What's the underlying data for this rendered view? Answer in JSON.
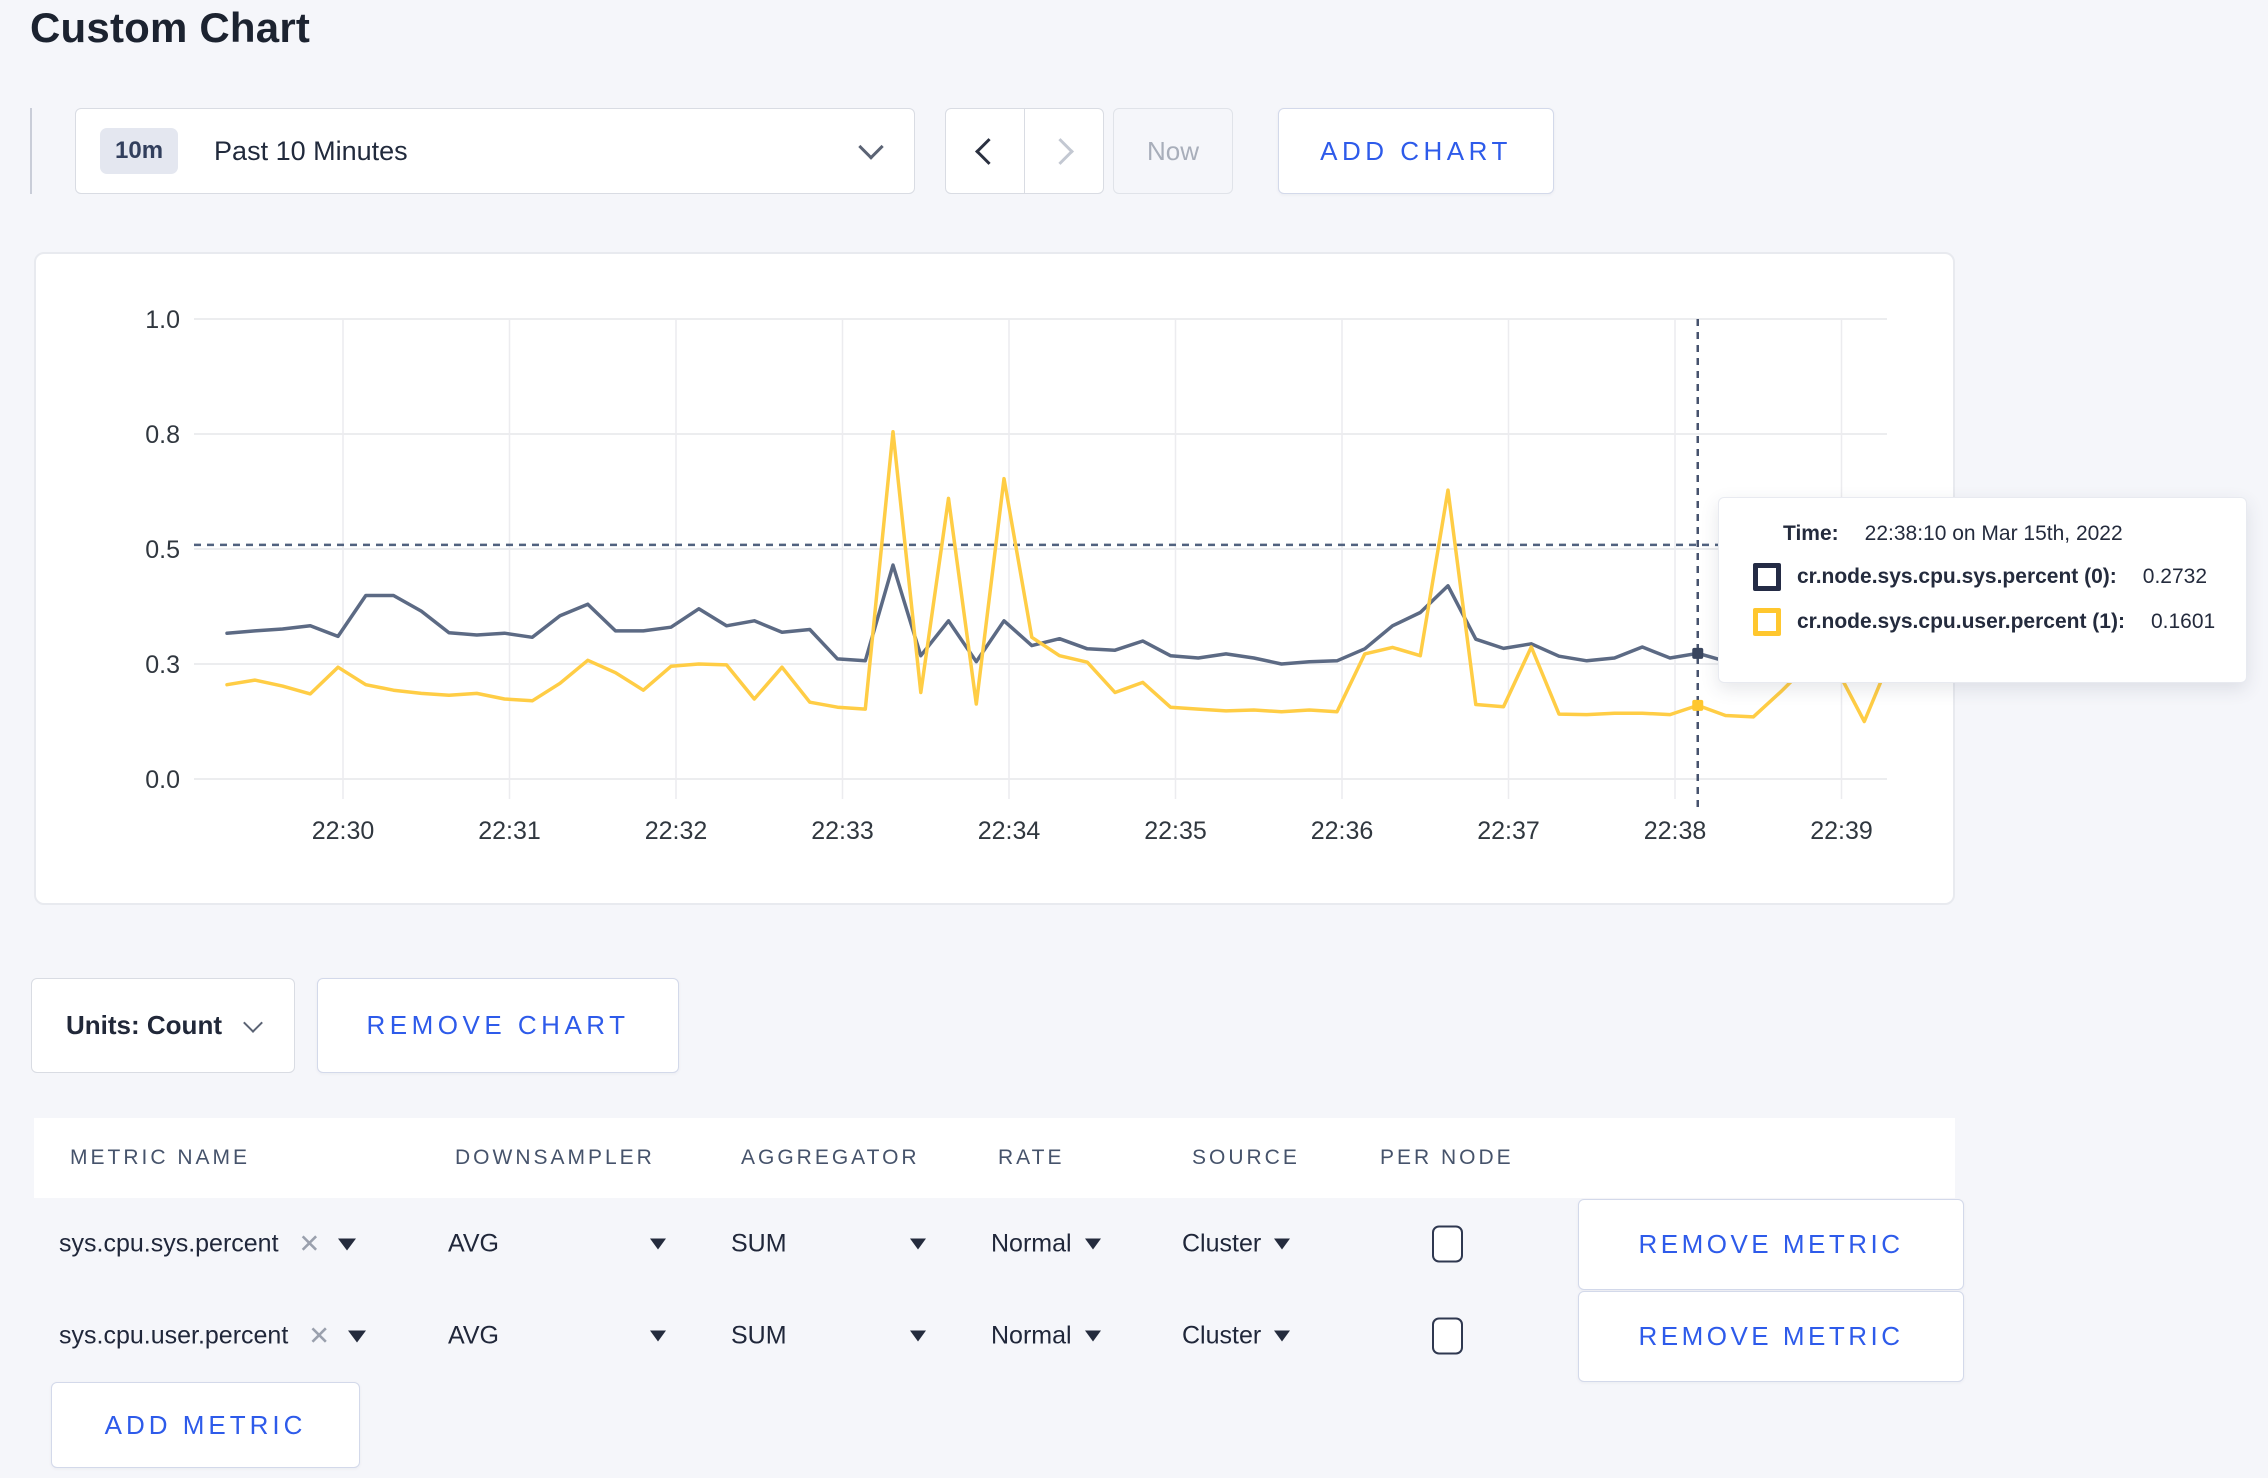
{
  "page": {
    "title": "Custom Chart",
    "background": "#f5f6fa",
    "accent": "#2e5bea"
  },
  "toolbar": {
    "time_badge": "10m",
    "time_label": "Past 10 Minutes",
    "now_label": "Now",
    "add_chart_label": "ADD CHART"
  },
  "chart_data": {
    "type": "line",
    "x_start": "22:29:20",
    "x_step_seconds": 10,
    "x_tick_labels": [
      "22:30",
      "22:31",
      "22:32",
      "22:33",
      "22:34",
      "22:35",
      "22:36",
      "22:37",
      "22:38",
      "22:39"
    ],
    "y_tick_labels": [
      "0.0",
      "0.3",
      "0.5",
      "0.8",
      "1.0"
    ],
    "y_tick_values": [
      0,
      0.25,
      0.5,
      0.75,
      1.0
    ],
    "ylim": [
      0,
      1
    ],
    "grid": true,
    "threshold_value": 0.509,
    "cursor_index": 53,
    "cursor_time": "22:38:10",
    "series": [
      {
        "name": "cr.node.sys.cpu.sys.percent (0)",
        "color": "#5c6a84",
        "dot": "#39455e",
        "values": [
          0.317,
          0.322,
          0.326,
          0.333,
          0.31,
          0.399,
          0.399,
          0.365,
          0.318,
          0.313,
          0.317,
          0.308,
          0.355,
          0.38,
          0.322,
          0.322,
          0.33,
          0.37,
          0.333,
          0.344,
          0.319,
          0.325,
          0.261,
          0.257,
          0.465,
          0.268,
          0.344,
          0.255,
          0.344,
          0.29,
          0.305,
          0.283,
          0.28,
          0.3,
          0.268,
          0.263,
          0.272,
          0.263,
          0.25,
          0.255,
          0.257,
          0.283,
          0.333,
          0.362,
          0.42,
          0.304,
          0.284,
          0.294,
          0.267,
          0.257,
          0.263,
          0.287,
          0.263,
          0.2732,
          0.256,
          0.27,
          0.3,
          0.285,
          0.295,
          0.305,
          0.31
        ]
      },
      {
        "name": "cr.node.sys.cpu.user.percent (1)",
        "color": "#ffcd45",
        "dot": "#ffc72e",
        "values": [
          0.205,
          0.215,
          0.202,
          0.185,
          0.243,
          0.205,
          0.193,
          0.186,
          0.182,
          0.186,
          0.174,
          0.17,
          0.208,
          0.258,
          0.231,
          0.193,
          0.245,
          0.25,
          0.248,
          0.174,
          0.243,
          0.167,
          0.156,
          0.152,
          0.755,
          0.188,
          0.61,
          0.163,
          0.653,
          0.308,
          0.268,
          0.254,
          0.188,
          0.21,
          0.156,
          0.152,
          0.148,
          0.15,
          0.146,
          0.15,
          0.146,
          0.272,
          0.286,
          0.268,
          0.628,
          0.162,
          0.157,
          0.287,
          0.141,
          0.14,
          0.143,
          0.143,
          0.14,
          0.1601,
          0.138,
          0.135,
          0.19,
          0.25,
          0.24,
          0.125,
          0.27
        ]
      }
    ]
  },
  "tooltip": {
    "time_label": "Time:",
    "time_value": "22:38:10 on Mar 15th, 2022",
    "rows": [
      {
        "label": "cr.node.sys.cpu.sys.percent (0):",
        "value": "0.2732",
        "color": "#242b45"
      },
      {
        "label": "cr.node.sys.cpu.user.percent (1):",
        "value": "0.1601",
        "color": "#ffc72e"
      }
    ]
  },
  "chart_footer": {
    "units_label": "Units: Count",
    "remove_chart_label": "REMOVE CHART"
  },
  "metrics_table": {
    "headers": [
      "METRIC NAME",
      "DOWNSAMPLER",
      "AGGREGATOR",
      "RATE",
      "SOURCE",
      "PER NODE"
    ],
    "rows": [
      {
        "metric": "sys.cpu.sys.percent",
        "downsampler": "AVG",
        "aggregator": "SUM",
        "rate": "Normal",
        "source": "Cluster",
        "per_node": false,
        "remove_label": "REMOVE METRIC"
      },
      {
        "metric": "sys.cpu.user.percent",
        "downsampler": "AVG",
        "aggregator": "SUM",
        "rate": "Normal",
        "source": "Cluster",
        "per_node": false,
        "remove_label": "REMOVE METRIC"
      }
    ],
    "add_metric_label": "ADD METRIC"
  }
}
